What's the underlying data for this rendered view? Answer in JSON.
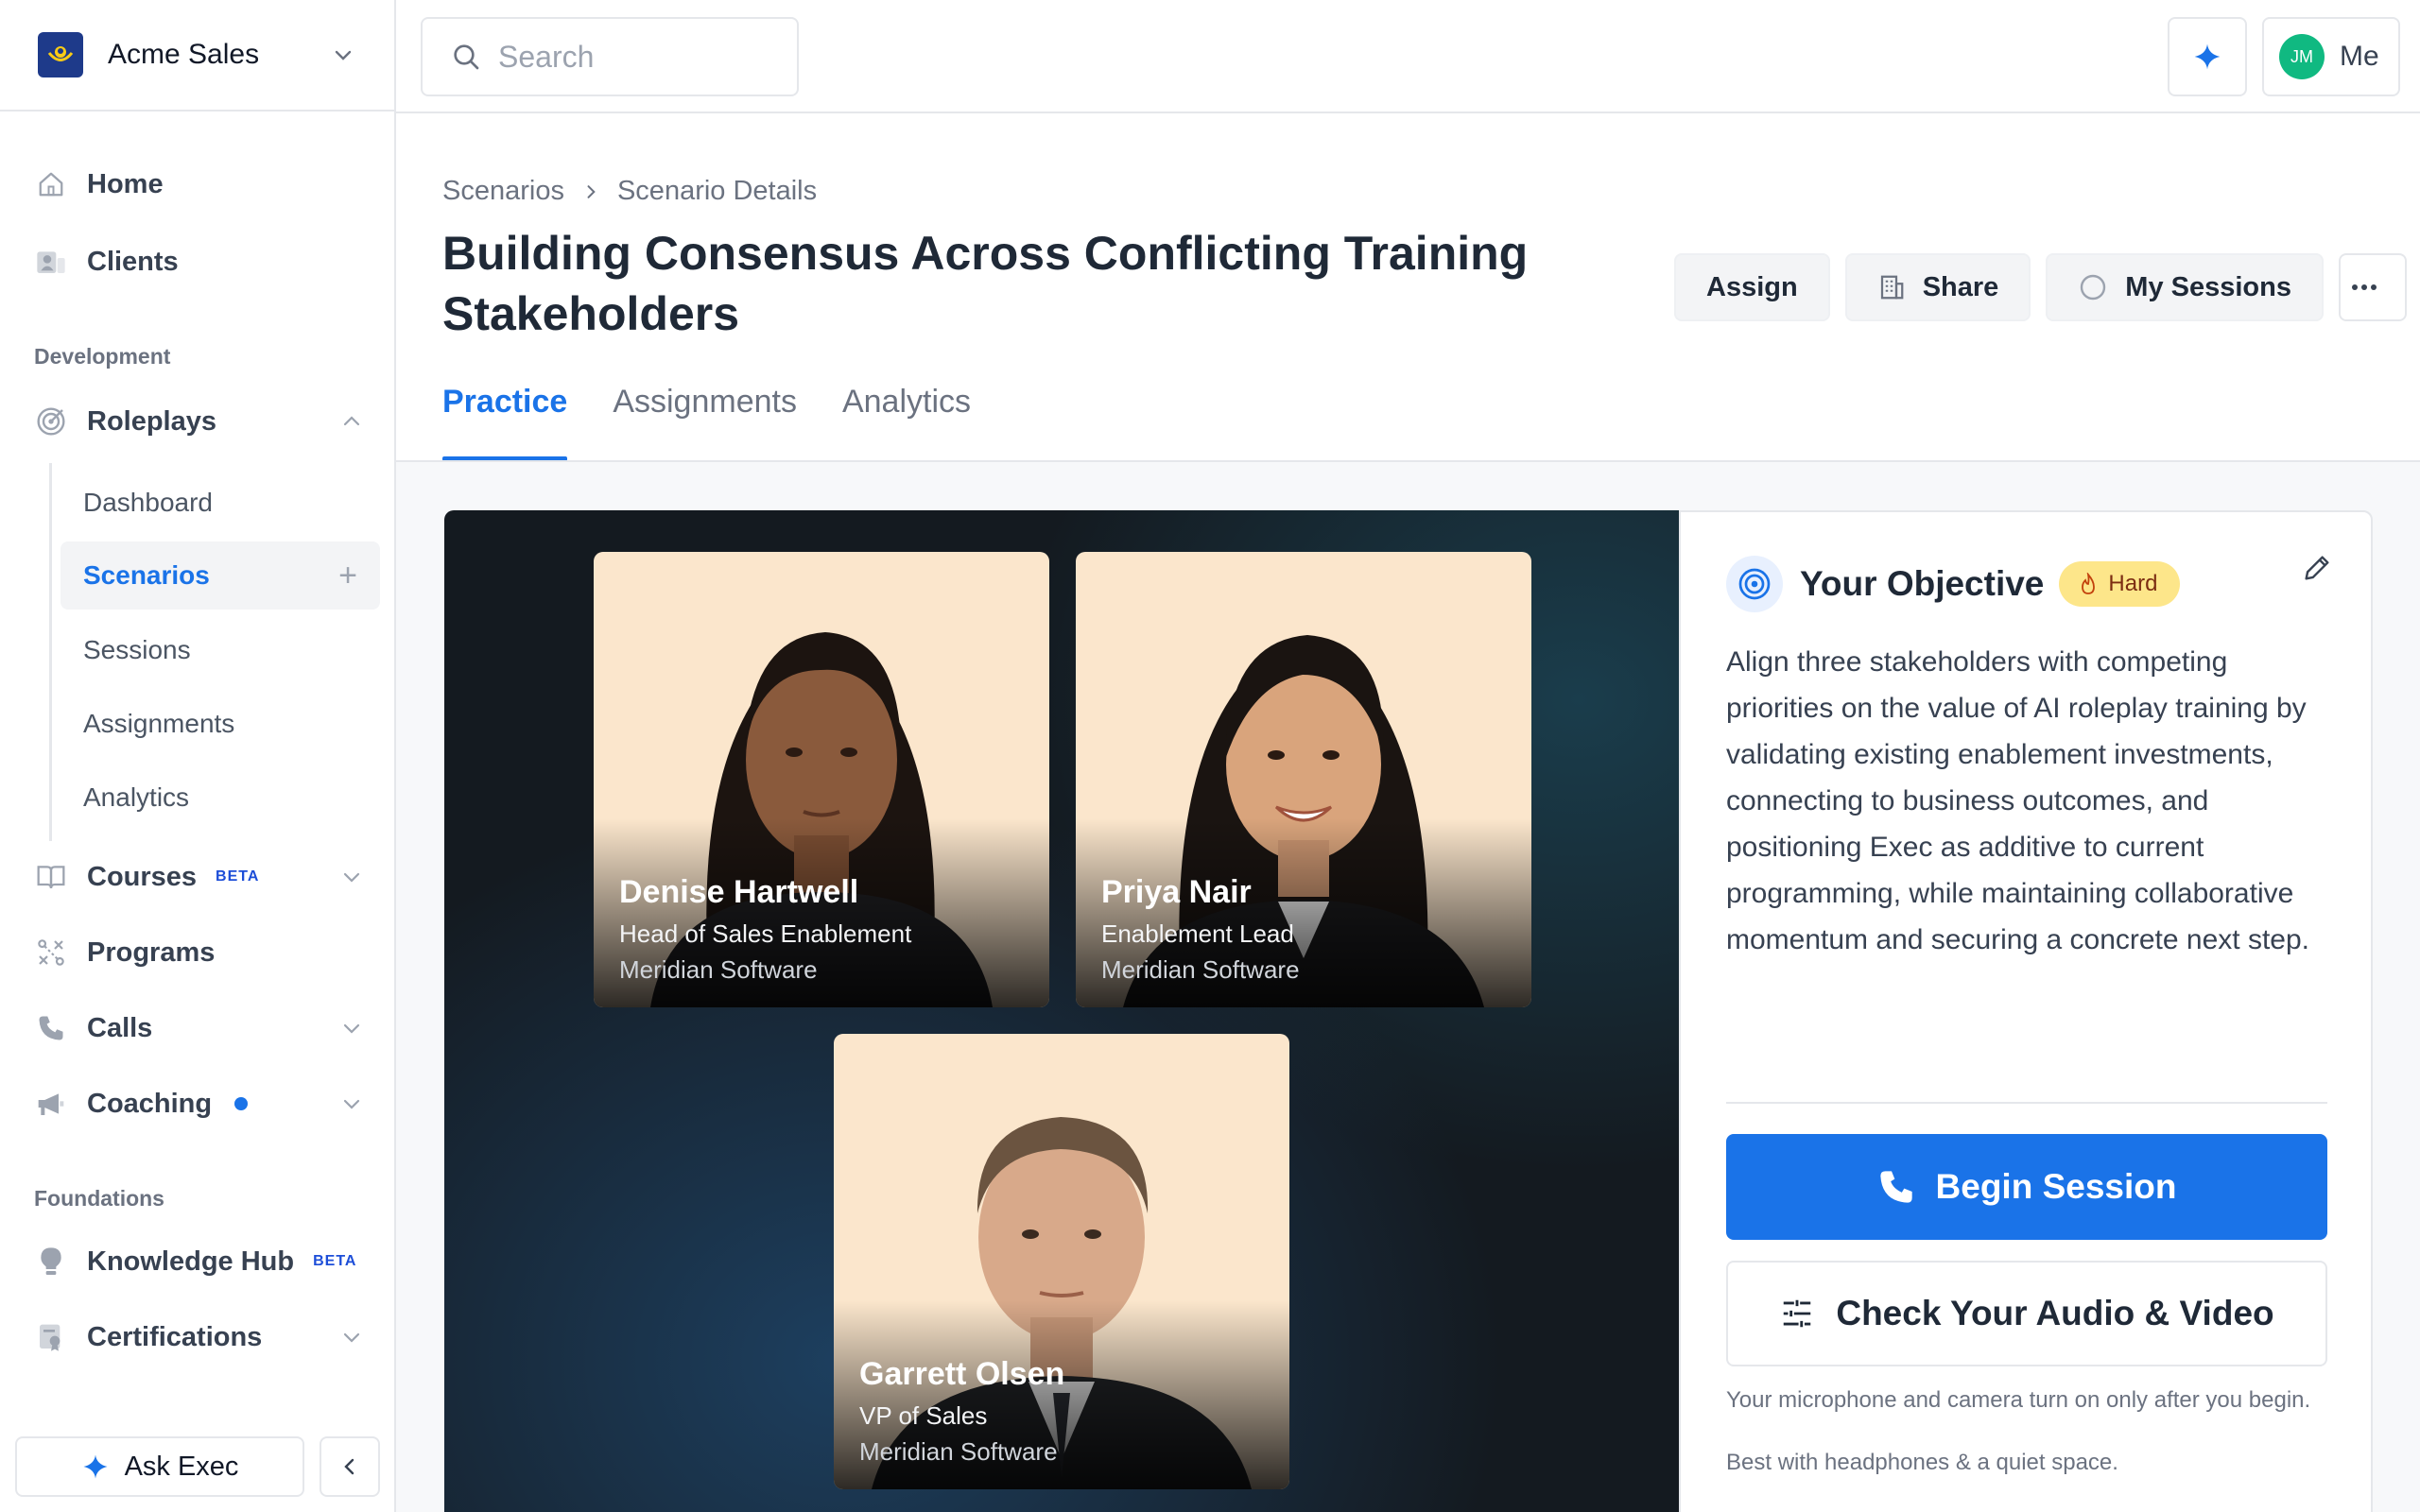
{
  "org": {
    "name": "Acme Sales"
  },
  "search": {
    "placeholder": "Search"
  },
  "user": {
    "initials": "JM",
    "label": "Me"
  },
  "colors": {
    "accent": "#1a73e8",
    "avatar": "#10b981",
    "hard_badge": "#fde68a",
    "stage_bg": "#141a20"
  },
  "sidebar": {
    "home": "Home",
    "clients": "Clients",
    "section_development": "Development",
    "roleplays": "Roleplays",
    "roleplay_items": [
      "Dashboard",
      "Scenarios",
      "Sessions",
      "Assignments",
      "Analytics"
    ],
    "courses": "Courses",
    "courses_badge": "BETA",
    "programs": "Programs",
    "calls": "Calls",
    "coaching": "Coaching",
    "section_foundations": "Foundations",
    "knowledge_hub": "Knowledge Hub",
    "knowledge_badge": "BETA",
    "certifications": "Certifications",
    "ask_label": "Ask Exec"
  },
  "breadcrumb": {
    "parent": "Scenarios",
    "current": "Scenario Details"
  },
  "page": {
    "title": "Building Consensus Across Conflicting Training Stakeholders"
  },
  "actions": {
    "assign": "Assign",
    "share": "Share",
    "my_sessions": "My Sessions"
  },
  "tabs": [
    "Practice",
    "Assignments",
    "Analytics"
  ],
  "personas": [
    {
      "name": "Denise Hartwell",
      "role": "Head of Sales Enablement",
      "company": "Meridian Software"
    },
    {
      "name": "Priya Nair",
      "role": "Enablement Lead",
      "company": "Meridian Software"
    },
    {
      "name": "Garrett Olsen",
      "role": "VP of Sales",
      "company": "Meridian Software"
    }
  ],
  "objective": {
    "title": "Your Objective",
    "difficulty": "Hard",
    "text": "Align three stakeholders with competing priorities on the value of AI roleplay training by validating existing enablement investments, connecting to business outcomes, and positioning Exec as additive to current programming, while maintaining collaborative momentum and securing a concrete next step.",
    "begin_label": "Begin Session",
    "check_label": "Check Your Audio & Video",
    "note_mic": "Your microphone and camera turn on only after you begin.",
    "note_headphones": "Best with headphones & a quiet space."
  }
}
